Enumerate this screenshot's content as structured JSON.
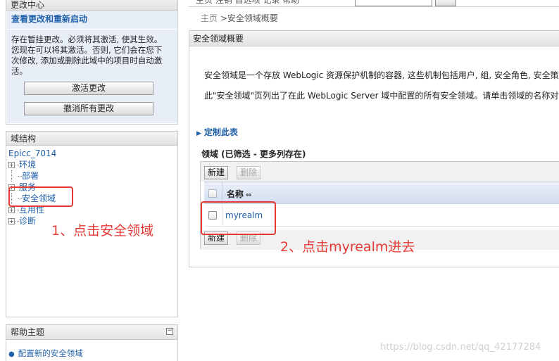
{
  "change_center": {
    "title": "更改中心",
    "subtitle": "查看更改和重新启动",
    "message_lines": [
      "存在暂挂更改。必须将其激活, 使其生效。",
      "您现在可以将其激活。否则, 它们会在您下",
      "次修改, 添加或删除此域中的项目时自动激",
      "活。"
    ],
    "activate_button": "激活更改",
    "undo_button": "撤消所有更改"
  },
  "domain_structure": {
    "title": "域结构",
    "root": "Epicc_7014",
    "items": [
      {
        "label": "环境",
        "expandable": true
      },
      {
        "label": "部署",
        "expandable": false
      },
      {
        "label": "服务",
        "expandable": true
      },
      {
        "label": "安全领域",
        "expandable": false
      },
      {
        "label": "互用性",
        "expandable": true
      },
      {
        "label": "诊断",
        "expandable": true
      }
    ]
  },
  "help_topics": {
    "title": "帮助主题",
    "collapse_symbol": "⊟",
    "links": [
      "配置新的安全领域"
    ]
  },
  "header": {
    "truncated_text": "主页  注销  首选项  记录  帮助"
  },
  "breadcrumb": {
    "home": "主页",
    "separator": ">",
    "current": "安全领域概要"
  },
  "main": {
    "title": "安全领域概要",
    "description_1": "安全领域是一个存放 WebLogic 资源保护机制的容器, 这些机制包括用户, 组, 安全角色, 安全策略",
    "description_2": "此\"安全领域\"页列出了在此 WebLogic Server 域中配置的所有安全领域。请单击领域的名称对该",
    "customize_link": "定制此表",
    "table_caption": "领域 (已筛选 - 更多列存在)",
    "new_button": "新建",
    "delete_button": "删除",
    "column_name": "名称",
    "sort_icon": "⇔",
    "rows": [
      {
        "name": "myrealm"
      }
    ]
  },
  "annotations": {
    "step1": "1、点击安全领域",
    "step2": "2、点击myrealm进去",
    "color": "#e53935"
  },
  "watermark": "https://blog.csdn.net/qq_42177284"
}
